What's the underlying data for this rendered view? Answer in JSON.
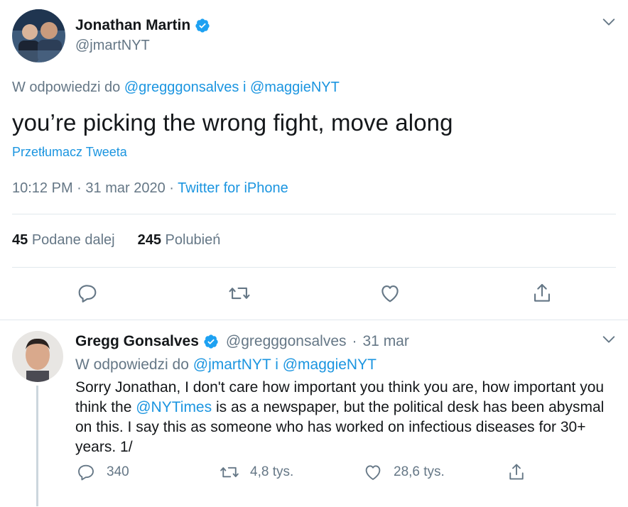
{
  "main_tweet": {
    "display_name": "Jonathan Martin",
    "handle": "@jmartNYT",
    "reply_prefix": "W odpowiedzi do",
    "reply_user1": "@gregggonsalves",
    "reply_join": "i",
    "reply_user2": "@maggieNYT",
    "text": "you’re picking the wrong fight, move along",
    "translate_label": "Przetłumacz Tweeta",
    "time": "10:12 PM",
    "date": "31 mar 2020",
    "dot": "·",
    "source": "Twitter for iPhone",
    "retweets_count": "45",
    "retweets_label": "Podane dalej",
    "likes_count": "245",
    "likes_label": "Polubień"
  },
  "reply_tweet": {
    "display_name": "Gregg Gonsalves",
    "handle": "@gregggonsalves",
    "dot": "·",
    "date": "31 mar",
    "reply_prefix": "W odpowiedzi do",
    "reply_user1": "@jmartNYT",
    "reply_join": "i",
    "reply_user2": "@maggieNYT",
    "text_part1": "Sorry Jonathan, I don't care how important you think you are, how important you think the",
    "text_mention": "@NYTimes",
    "text_part2": "is as a newspaper, but the political desk has been abysmal on this. I say this as someone who has worked on infectious diseases for 30+ years. 1/",
    "replies_count": "340",
    "retweets_count": "4,8 tys.",
    "likes_count": "28,6 tys."
  },
  "icons": {
    "verified": "verified-badge-icon",
    "chevron": "chevron-down-icon",
    "reply": "reply-icon",
    "retweet": "retweet-icon",
    "like": "heart-icon",
    "share": "share-icon"
  },
  "colors": {
    "accent": "#1b95e0",
    "secondary_text": "#657786",
    "divider": "#e1e8ed",
    "icon": "#657786"
  }
}
